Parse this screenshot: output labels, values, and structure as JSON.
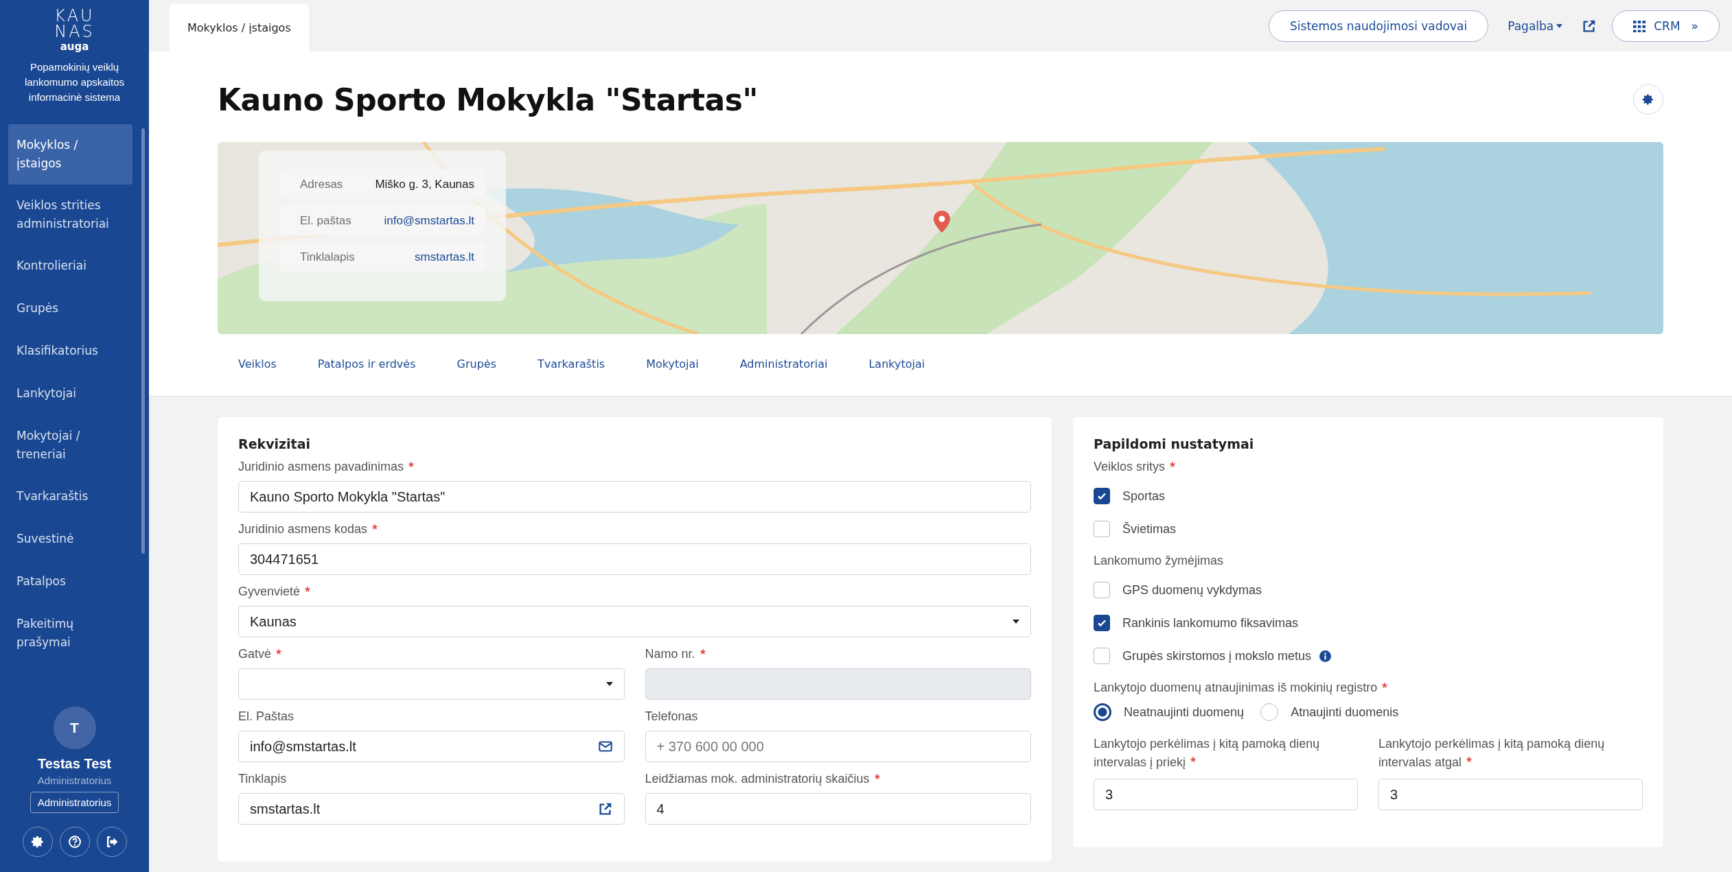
{
  "sidebar": {
    "logo": {
      "line1": "KAU",
      "line2": "NAS",
      "tagline": "auga"
    },
    "app_name": "Popamokinių veiklų lankomumo apskaitos informacinė sistema",
    "items": [
      {
        "label": "Mokyklos / įstaigos",
        "selected": true
      },
      {
        "label": "Veiklos strities administratoriai",
        "selected": false
      },
      {
        "label": "Kontrolieriai",
        "selected": false
      },
      {
        "label": "Grupės",
        "selected": false
      },
      {
        "label": "Klasifikatorius",
        "selected": false
      },
      {
        "label": "Lankytojai",
        "selected": false
      },
      {
        "label": "Mokytojai / treneriai",
        "selected": false
      },
      {
        "label": "Tvarkaraštis",
        "selected": false
      },
      {
        "label": "Suvestinė",
        "selected": false
      },
      {
        "label": "Patalpos",
        "selected": false
      },
      {
        "label": "Pakeitimų prašymai",
        "selected": false
      }
    ],
    "user": {
      "initial": "T",
      "name": "Testas Test",
      "role": "Administratorius",
      "role_button": "Administratorius"
    }
  },
  "top_bar": {
    "tabs": [
      {
        "label": "Mokyklos / įstaigos",
        "selected": true
      }
    ],
    "guide_button": "Sistemos naudojimosi vadovai",
    "help_menu": "Pagalba",
    "crm_button": "CRM",
    "crm_chevron": "»"
  },
  "page": {
    "title": "Kauno Sporto Mokykla \"Startas\"",
    "info": [
      {
        "label": "Adresas",
        "value": "Miško g. 3, Kaunas",
        "kind": "text"
      },
      {
        "label": "El. paštas",
        "value": "info@smstartas.lt",
        "kind": "link"
      },
      {
        "label": "Tinklalapis",
        "value": "smstartas.lt",
        "kind": "link"
      }
    ],
    "tabs": [
      {
        "label": "Veiklos",
        "selected": false
      },
      {
        "label": "Patalpos ir erdvės",
        "selected": false
      },
      {
        "label": "Grupės",
        "selected": false
      },
      {
        "label": "Tvarkaraštis",
        "selected": false
      },
      {
        "label": "Mokytojai",
        "selected": false
      },
      {
        "label": "Administratoriai",
        "selected": false
      },
      {
        "label": "Lankytojai",
        "selected": false
      }
    ]
  },
  "requisites": {
    "title": "Rekvizitai",
    "rows": [
      [
        {
          "label": "Juridinio asmens pavadinimas",
          "required": true,
          "kind": "text",
          "value": "Kauno Sporto Mokykla \"Startas\""
        }
      ],
      [
        {
          "label": "Juridinio asmens kodas",
          "required": true,
          "kind": "text",
          "value": "304471651"
        }
      ],
      [
        {
          "label": "Gyvenvietė",
          "required": true,
          "kind": "select",
          "value": "Kaunas"
        }
      ],
      [
        {
          "label": "Gatvė",
          "required": true,
          "kind": "select"
        },
        {
          "label": "Namo nr.",
          "required": true,
          "kind": "disabled"
        }
      ],
      [
        {
          "label": "El. Paštas",
          "required": false,
          "kind": "email",
          "value": "info@smstartas.lt"
        },
        {
          "label": "Telefonas",
          "required": false,
          "kind": "text",
          "placeholder": "+ 370 600 00 000"
        }
      ],
      [
        {
          "label": "Tinklapis",
          "required": false,
          "kind": "link",
          "value": "smstartas.lt"
        },
        {
          "label": "Leidžiamas mok. administratorių skaičius",
          "required": true,
          "kind": "text",
          "value": "4"
        }
      ]
    ]
  },
  "settings": {
    "title": "Papildomi nustatymai",
    "groups": [
      {
        "kind": "checkbox",
        "label": "Veiklos sritys",
        "required": true,
        "options": [
          {
            "label": "Sportas",
            "checked": true,
            "info": false
          },
          {
            "label": "Švietimas",
            "checked": false,
            "info": false
          }
        ]
      },
      {
        "kind": "checkbox",
        "label": "Lankomumo žymėjimas",
        "required": false,
        "options": [
          {
            "label": "GPS duomenų vykdymas",
            "checked": false,
            "info": false
          },
          {
            "label": "Rankinis lankomumo fiksavimas",
            "checked": true,
            "info": false
          },
          {
            "label": "Grupės skirstomos į mokslo metus",
            "checked": false,
            "info": true
          }
        ]
      },
      {
        "kind": "radio",
        "label": "Lankytojo duomenų atnaujinimas iš mokinių registro",
        "required": true,
        "options": [
          {
            "label": "Neatnaujinti duomenų",
            "selected": true
          },
          {
            "label": "Atnaujinti duomenis",
            "selected": false
          }
        ]
      }
    ],
    "fields": [
      {
        "label": "Lankytojo perkėlimas į kitą pamoką dienų intervalas į priekį",
        "required": true,
        "value": "3"
      },
      {
        "label": "Lankytojo perkėlimas į kitą pamoką dienų intervalas atgal",
        "required": true,
        "value": "3"
      }
    ]
  }
}
